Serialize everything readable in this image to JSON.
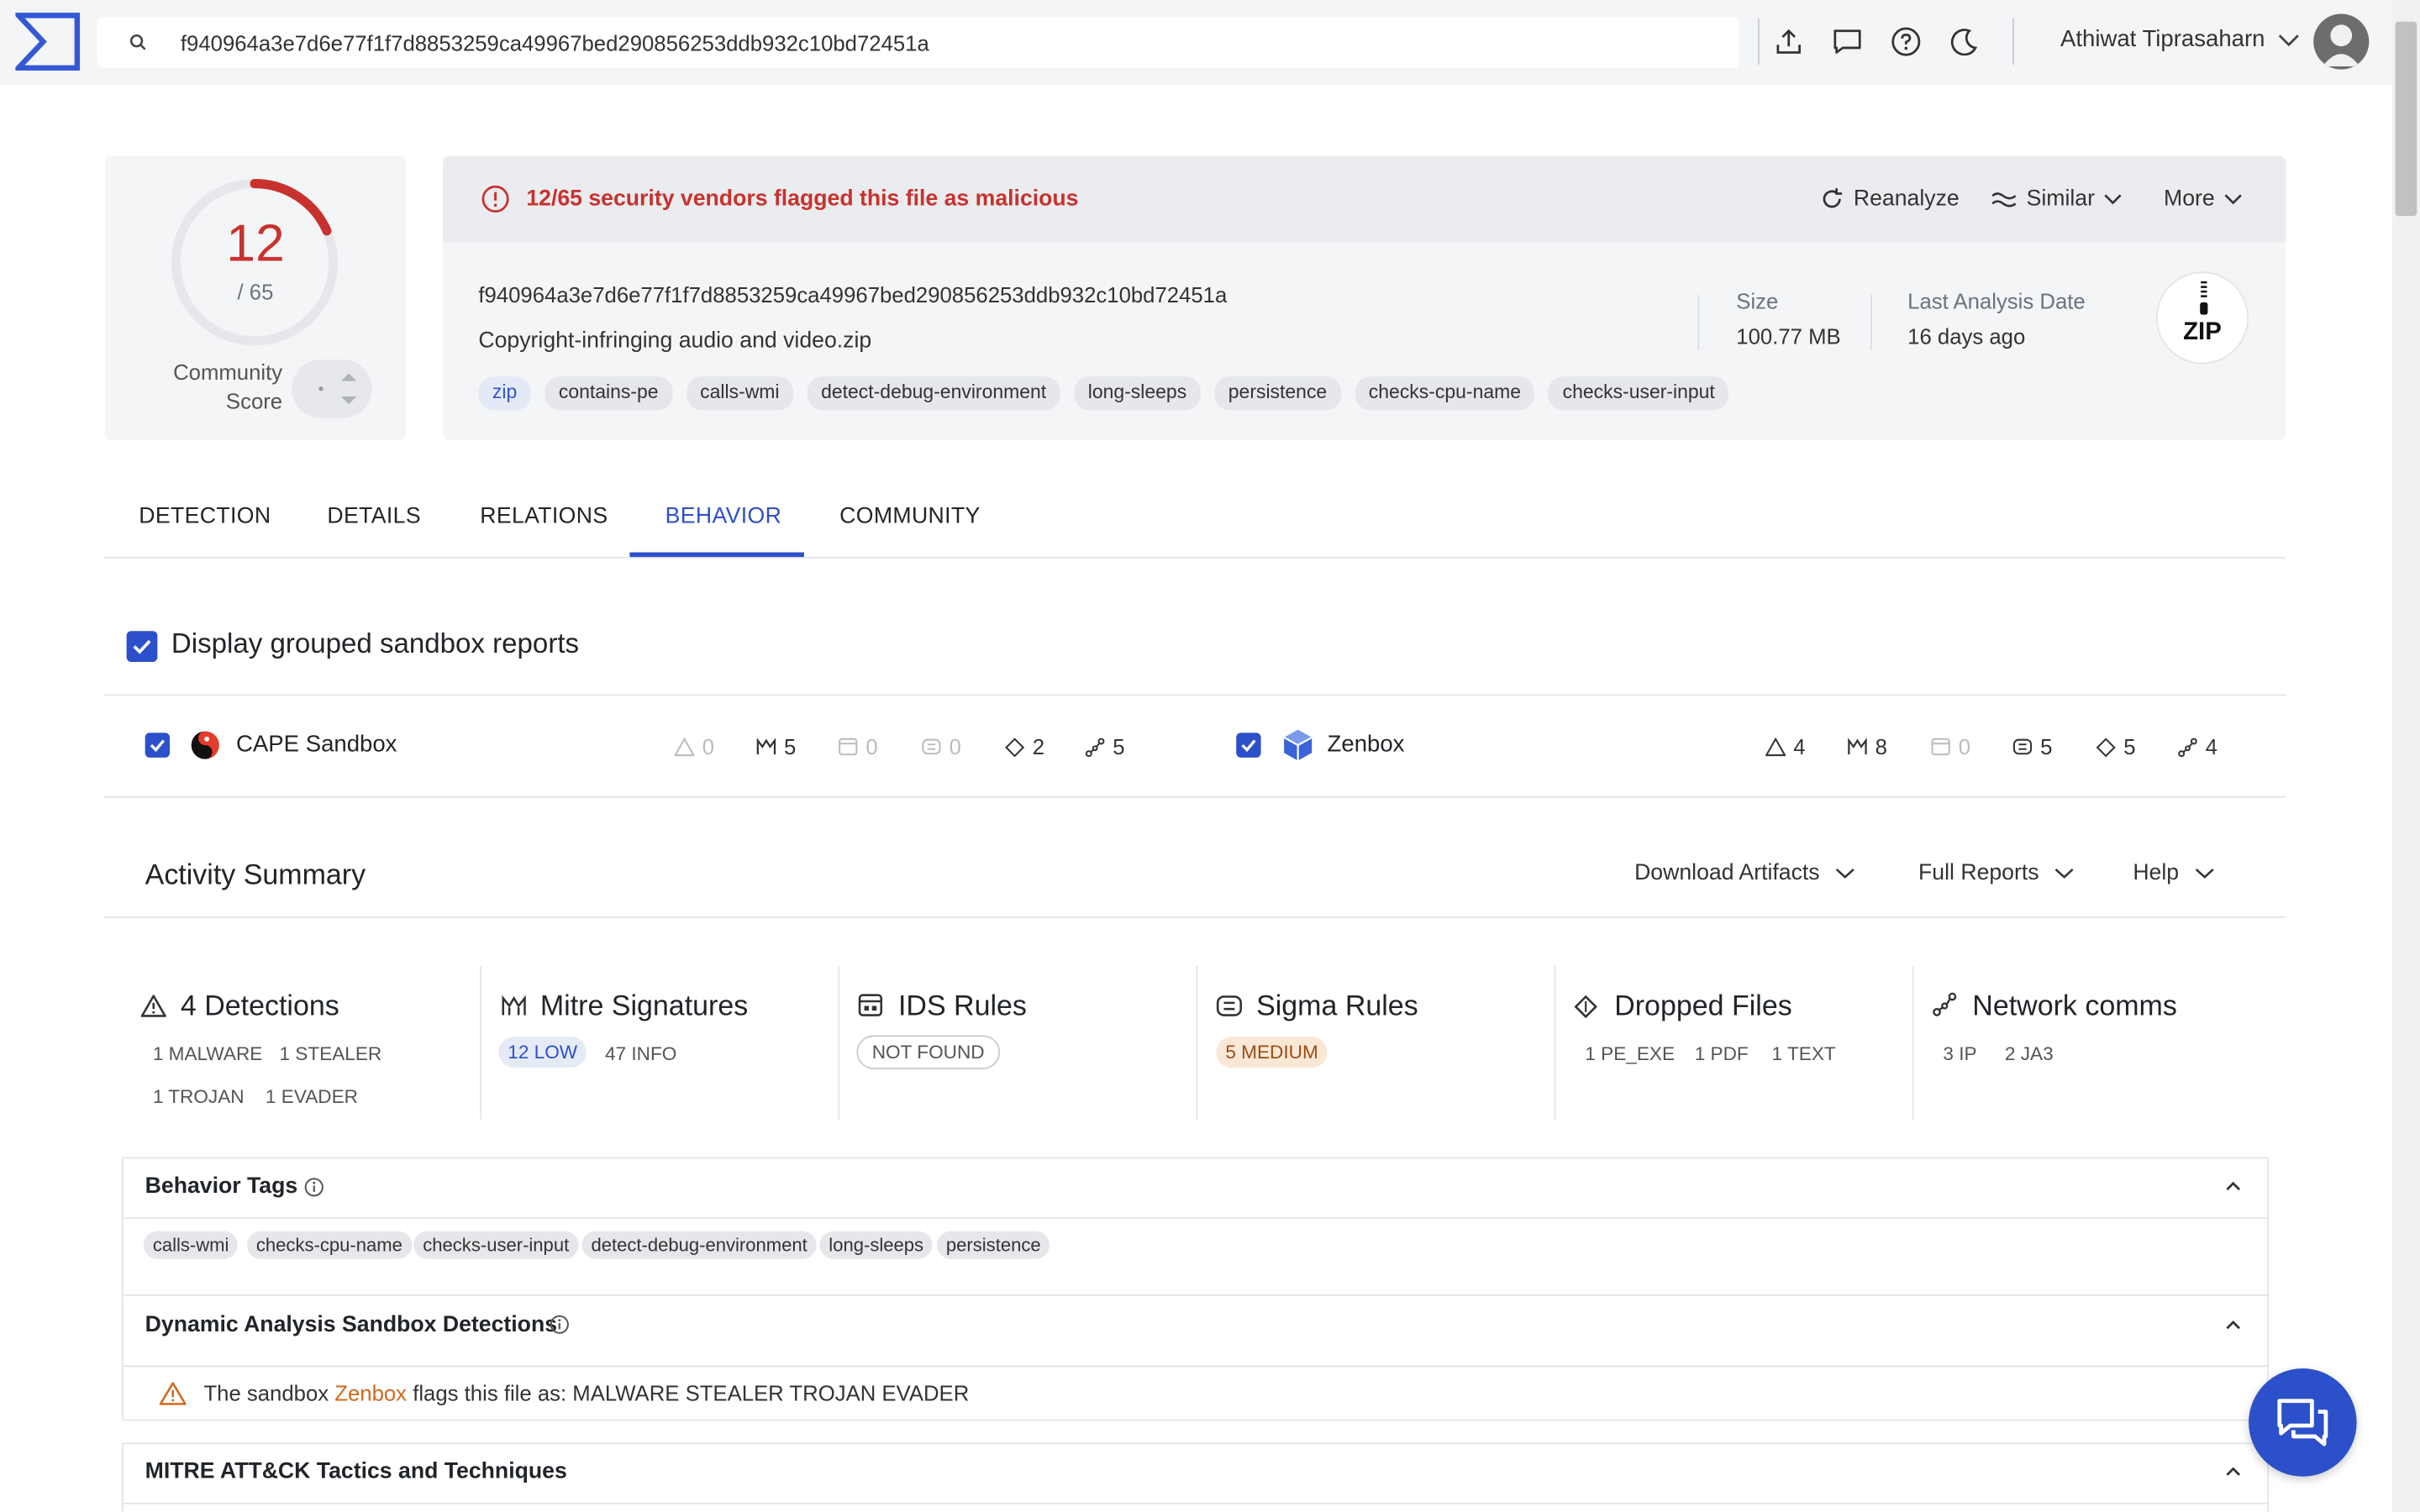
{
  "search": {
    "query": "f940964a3e7d6e77f1f7d8853259ca49967bed290856253ddb932c10bd72451a"
  },
  "user": {
    "name": "Athiwat Tiprasaharn"
  },
  "score": {
    "value": "12",
    "total": "/ 65",
    "community_label_1": "Community",
    "community_label_2": "Score",
    "fraction_flagged": 0.1846,
    "accent": "#c8322e"
  },
  "alert": {
    "text": "12/65 security vendors flagged this file as malicious"
  },
  "actions": {
    "reanalyze": "Reanalyze",
    "similar": "Similar",
    "more": "More"
  },
  "file": {
    "hash": "f940964a3e7d6e77f1f7d8853259ca49967bed290856253ddb932c10bd72451a",
    "name": "Copyright-infringing audio and video.zip",
    "tags": [
      "zip",
      "contains-pe",
      "calls-wmi",
      "detect-debug-environment",
      "long-sleeps",
      "persistence",
      "checks-cpu-name",
      "checks-user-input"
    ],
    "size_label": "Size",
    "size_value": "100.77 MB",
    "date_label": "Last Analysis Date",
    "date_value": "16 days ago",
    "type_icon": "ZIP"
  },
  "tabs": [
    "DETECTION",
    "DETAILS",
    "RELATIONS",
    "BEHAVIOR",
    "COMMUNITY"
  ],
  "active_tab": "BEHAVIOR",
  "grouped": {
    "label": "Display grouped sandbox reports",
    "checked": true
  },
  "sandboxes": [
    {
      "name": "CAPE Sandbox",
      "checked": true,
      "stats": [
        "0",
        "5",
        "0",
        "0",
        "2",
        "5"
      ]
    },
    {
      "name": "Zenbox",
      "checked": true,
      "stats": [
        "4",
        "8",
        "0",
        "5",
        "5",
        "4"
      ]
    }
  ],
  "activity": {
    "title": "Activity Summary",
    "dropdowns": [
      "Download Artifacts",
      "Full Reports",
      "Help"
    ],
    "cards": [
      {
        "title": "4 Detections",
        "pills": [
          "1 MALWARE",
          "1 STEALER",
          "1 TROJAN",
          "1 EVADER"
        ]
      },
      {
        "title": "Mitre Signatures",
        "pills": [
          "12 LOW",
          "47 INFO"
        ]
      },
      {
        "title": "IDS Rules",
        "pills": [
          "NOT FOUND"
        ]
      },
      {
        "title": "Sigma Rules",
        "pills": [
          "5 MEDIUM"
        ]
      },
      {
        "title": "Dropped Files",
        "pills": [
          "1 PE_EXE",
          "1 PDF",
          "1 TEXT"
        ]
      },
      {
        "title": "Network comms",
        "pills": [
          "3 IP",
          "2 JA3"
        ]
      }
    ]
  },
  "behavior_tags": {
    "title": "Behavior Tags",
    "tags": [
      "calls-wmi",
      "checks-cpu-name",
      "checks-user-input",
      "detect-debug-environment",
      "long-sleeps",
      "persistence"
    ]
  },
  "dynamic": {
    "title": "Dynamic Analysis Sandbox Detections",
    "prefix": "The sandbox",
    "sandbox": "Zenbox",
    "suffix": "flags this file as: MALWARE STEALER TROJAN EVADER"
  },
  "mitre": {
    "title": "MITRE ATT&CK Tactics and Techniques"
  },
  "colors": {
    "primary": "#2c50c9",
    "danger": "#c8322e",
    "panel": "#f4f5f7"
  }
}
